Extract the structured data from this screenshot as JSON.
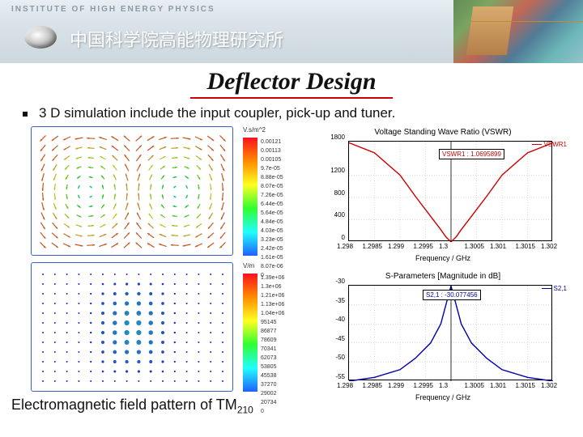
{
  "banner": {
    "inst_en": "INSTITUTE OF HIGH ENERGY PHYSICS",
    "inst_cn": "中国科学院高能物理研究所"
  },
  "title": "Deflector Design",
  "bullet": "3 D simulation include the input coupler, pick-up and tuner.",
  "colorbar_top": {
    "header": "V.s/m^2",
    "ticks": [
      "0.00121",
      "0.00113",
      "0.00105",
      "9.7e-05",
      "8.88e-05",
      "8.07e-05",
      "7.26e-05",
      "6.44e-05",
      "5.64e-05",
      "4.84e-05",
      "4.03e-05",
      "3.23e-05",
      "2.42e-05",
      "1.61e-05",
      "8.07e-06",
      "0"
    ]
  },
  "colorbar_bot": {
    "header": "V/m",
    "ticks": [
      "1.39e+06",
      "1.3e+06",
      "1.21e+06",
      "1.13e+06",
      "1.04e+06",
      "95145",
      "86877",
      "78609",
      "70341",
      "62073",
      "53805",
      "45538",
      "37270",
      "29002",
      "20734",
      "0"
    ]
  },
  "caption_pre": "Electromagnetic field pattern of TM",
  "caption_sub": "210",
  "chart_data": [
    {
      "type": "line",
      "title": "Voltage Standing Wave Ratio (VSWR)",
      "legend_box": "VSWR1 : 1.0695899",
      "legend_right": "VSWR1",
      "legend_color": "#c00",
      "xlabel": "Frequency / GHz",
      "ylabel": "",
      "xticks": [
        "1.298",
        "1.2985",
        "1.299",
        "1.2995",
        "1.3",
        "1.3005",
        "1.301",
        "1.3015",
        "1.302"
      ],
      "yticks": [
        "1800",
        "1200",
        "800",
        "400",
        "0"
      ],
      "xlim": [
        1.298,
        1.302
      ],
      "ylim": [
        0,
        1800
      ],
      "series": [
        {
          "name": "VSWR1",
          "x": [
            1.298,
            1.2985,
            1.299,
            1.2993,
            1.2996,
            1.2998,
            1.2999,
            1.3,
            1.3001,
            1.3002,
            1.3004,
            1.3007,
            1.301,
            1.3015,
            1.302
          ],
          "y": [
            1780,
            1600,
            1200,
            820,
            460,
            220,
            90,
            1.07,
            90,
            220,
            460,
            820,
            1200,
            1600,
            1780
          ]
        }
      ]
    },
    {
      "type": "line",
      "title": "S-Parameters [Magnitude in dB]",
      "legend_box": "S2,1 : -30.077456",
      "legend_right": "S2,1",
      "legend_color": "#00a",
      "xlabel": "Frequency / GHz",
      "ylabel": "",
      "xticks": [
        "1.298",
        "1.2985",
        "1.299",
        "1.2995",
        "1.3",
        "1.3005",
        "1.301",
        "1.3015",
        "1.302"
      ],
      "yticks": [
        "-30",
        "-35",
        "-40",
        "-45",
        "-50",
        "-55"
      ],
      "xlim": [
        1.298,
        1.302
      ],
      "ylim": [
        -55,
        -30
      ],
      "series": [
        {
          "name": "S2,1",
          "x": [
            1.298,
            1.2985,
            1.299,
            1.2993,
            1.2996,
            1.2998,
            1.2999,
            1.3,
            1.3001,
            1.3002,
            1.3004,
            1.3007,
            1.301,
            1.3015,
            1.302
          ],
          "y": [
            -55,
            -54,
            -52,
            -49,
            -45,
            -40,
            -35,
            -30.08,
            -35,
            -40,
            -45,
            -49,
            -52,
            -54,
            -55
          ]
        }
      ]
    }
  ]
}
